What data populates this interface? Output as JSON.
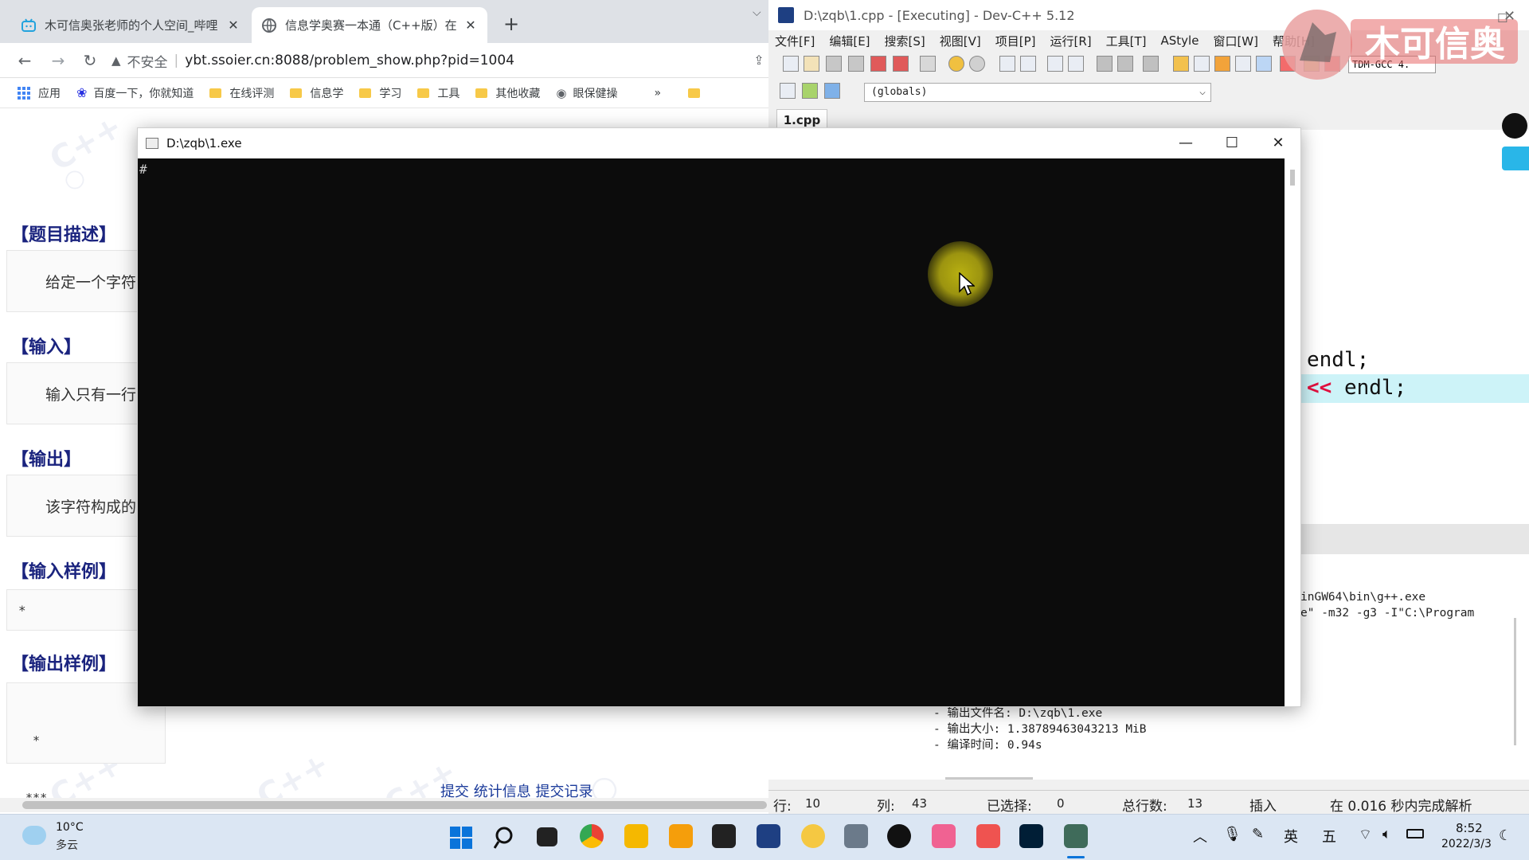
{
  "browser": {
    "tabs": [
      {
        "title": "木可信奥张老师的个人空间_哔哩",
        "close": "✕"
      },
      {
        "title": "信息学奥赛一本通（C++版）在线",
        "close": "✕"
      }
    ],
    "new_tab": "+",
    "url_warning": "不安全",
    "url": "ybt.ssoier.cn:8088/problem_show.php?pid=1004",
    "bookmarks": [
      "应用",
      "百度一下，你就知道",
      "在线评测",
      "信息学",
      "学习",
      "工具",
      "其他收藏",
      "眼保健操"
    ],
    "bookmarks_more": "»",
    "page": {
      "sections": [
        "【题目描述】",
        "【输入】",
        "【输出】",
        "【输入样例】",
        "【输出样例】"
      ],
      "desc_text": "给定一个字符",
      "input_text": "输入只有一行",
      "output_text": "该字符构成的",
      "sample_input": "*",
      "sample_output": [
        "  *",
        " ***",
        "*****"
      ],
      "bottom_links": "提交 统计信息 提交记录"
    }
  },
  "devcpp": {
    "title": "D:\\zqb\\1.cpp - [Executing] - Dev-C++ 5.12",
    "menu": [
      "文件[F]",
      "编辑[E]",
      "搜索[S]",
      "视图[V]",
      "项目[P]",
      "运行[R]",
      "工具[T]",
      "AStyle",
      "窗口[W]",
      "帮助[H]"
    ],
    "compiler": "TDM-GCC 4.",
    "scope": "(globals)",
    "file_tab": "1.cpp",
    "code_line1": "endl;",
    "code_line2_op": "<<",
    "code_line2_rest": "endl;",
    "log_lines": [
      "inGW64\\bin\\g++.exe",
      "e\" -m32 -g3 -I\"C:\\Program",
      "- 输出文件名: D:\\zqb\\1.exe",
      "- 输出大小: 1.38789463043213 MiB",
      "- 编译时间: 0.94s"
    ],
    "status": {
      "row_label": "行:",
      "row": "10",
      "col_label": "列:",
      "col": "43",
      "sel_label": "已选择:",
      "sel": "0",
      "lines_label": "总行数:",
      "lines": "13",
      "mode": "插入",
      "parse": "在 0.016 秒内完成解析"
    }
  },
  "console": {
    "title": "D:\\zqb\\1.exe",
    "output": "#",
    "minimize": "—",
    "maximize": "☐",
    "close": "✕"
  },
  "taskbar": {
    "weather_temp": "10°C",
    "weather_desc": "多云",
    "ime1": "英",
    "ime2": "五",
    "time": "8:52",
    "date": "2022/3/3"
  },
  "logo_text": "木可信奥"
}
